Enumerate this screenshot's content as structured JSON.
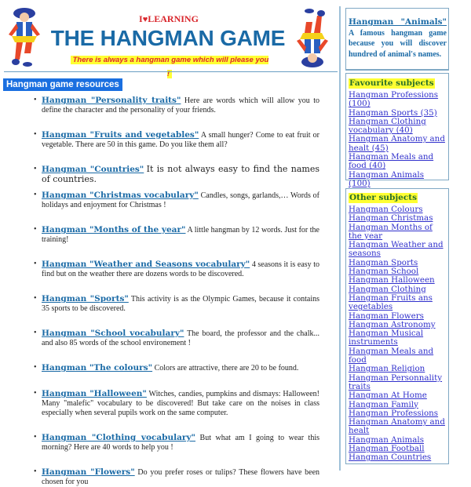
{
  "header": {
    "brand_prefix": "I",
    "brand_heart": "♥",
    "brand_suffix": "LEARNING",
    "title": "THE HANGMAN GAME",
    "tagline": "There is always a hangman game which will please you !",
    "mascot_left": "jester-mascot-icon",
    "mascot_right": "upside-down-jester-mascot-icon"
  },
  "section": {
    "label": "Hangman game resources"
  },
  "resources": [
    {
      "link": "Hangman \"Personality traits\"",
      "desc": "Here are words which will allow you to define the character and the personality of your friends."
    },
    {
      "link": "Hangman \"Fruits and vegetables\"",
      "desc": "A small hunger? Come to eat fruit or vegetable. There are 50 in this game. Do you like them all?"
    },
    {
      "link": "Hangman \"Countries\"",
      "desc": "It is not always easy to find the names of countries."
    },
    {
      "link": "Hangman \"Christmas vocabulary\"",
      "desc": "Candles, songs, garlands,… Words of holidays and enjoyment for Christmas !"
    },
    {
      "link": "Hangman \"Months of the year\"",
      "desc": "A little hangman by 12 words. Just for the training!"
    },
    {
      "link": "Hangman \"Weather and Seasons vocabulary\"",
      "desc": "4 seasons it is easy to find but on the weather there are dozens words to be discovered."
    },
    {
      "link": "Hangman \"Sports\"",
      "desc": "This activity is as the Olympic Games, because it contains 35 sports to be discovered."
    },
    {
      "link": "Hangman \"School vocabulary\"",
      "desc": "The board, the professor and the chalk... and also 85 words of the school environement !"
    },
    {
      "link": "Hangman \"The colours\"",
      "desc": "Colors are attractive, there are 20 to be found."
    },
    {
      "link": "Hangman \"Halloween\"",
      "desc": "Witches, candies, pumpkins and dismays: Halloween! Many \"malefic\" vocabulary to be discovered! But take care on the noises in class especially when several pupils work on the same computer."
    },
    {
      "link": "Hangman \"Clothing vocabulary\"",
      "desc": "But what am I going to wear this morning? Here are 40 words to help you !"
    },
    {
      "link": "Hangman \"Flowers\"",
      "desc": "Do you prefer roses or tulips? These flowers have been chosen for you"
    }
  ],
  "sidebar": {
    "featured": {
      "link": "Hangman \"Animals\"",
      "desc": "A famous hangman game because you will discover hundred of animal's names."
    },
    "favourite": {
      "heading": "Favourite subjects",
      "links": [
        "Hangman Professions (100)",
        "Hangman Sports (35)",
        "Hangman Clothing vocabulary (40)",
        "Hangman Anatomy and healt (45)",
        "Hangman  Meals and food (40)",
        "Hangman  Animals (100)"
      ]
    },
    "other": {
      "heading": "Other subjects",
      "links": [
        "Hangman Colours",
        "Hangman Christmas ",
        "Hangman Months of the year",
        "Hangman Weather and seasons",
        "Hangman  Sports ",
        "Hangman  School ",
        "Hangman  Halloween ",
        "Hangman  Clothing",
        "Hangman  Fruits ans vegetables",
        "Hangman  Flowers",
        "Hangman  Astronomy",
        "Hangman  Musical instruments",
        "Hangman  Meals and food ",
        "Hangman  Religion",
        "Hangman  Personnality traits",
        "Hangman  At Home",
        "Hangman  Family",
        "Hangman  Professions",
        "Hangman  Anatomy and healt",
        "Hangman  Animals",
        "Hangman  Football",
        "Hangman  Countries"
      ]
    }
  },
  "colors": {
    "title_blue": "#1a6aa6",
    "brand_red": "#d9262c",
    "highlight_yellow": "#ffff33",
    "section_blue": "#1a6fe0",
    "link_blue": "#1a6aa6",
    "sidebar_link": "#3030cc",
    "heading_green": "#2a6f2a"
  }
}
